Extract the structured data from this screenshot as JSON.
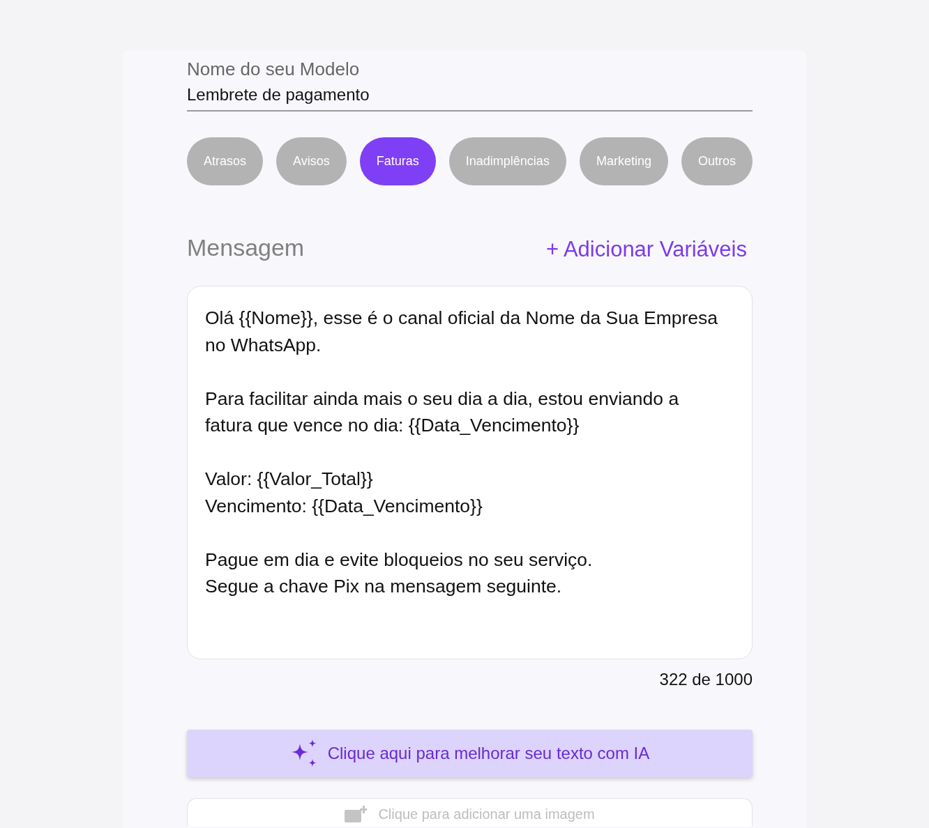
{
  "template_name": {
    "label": "Nome do seu Modelo",
    "value": "Lembrete de pagamento"
  },
  "categories": [
    {
      "label": "Atrasos",
      "selected": false
    },
    {
      "label": "Avisos",
      "selected": false
    },
    {
      "label": "Faturas",
      "selected": true
    },
    {
      "label": "Inadimplências",
      "selected": false
    },
    {
      "label": "Marketing",
      "selected": false
    },
    {
      "label": "Outros",
      "selected": false
    }
  ],
  "message": {
    "title": "Mensagem",
    "add_variables": "+ Adicionar Variáveis",
    "value": "Olá {{Nome}}, esse é o canal oficial da Nome da Sua Empresa no WhatsApp.\n\nPara facilitar ainda mais o seu dia a dia, estou enviando a fatura que vence no dia: {{Data_Vencimento}}\n\nValor: {{Valor_Total}}\nVencimento: {{Data_Vencimento}}\n\nPague em dia e evite bloqueios no seu serviço.\nSegue a chave Pix na mensagem seguinte.",
    "counter": "322 de 1000"
  },
  "ai_button": {
    "label": "Clique aqui para melhorar seu texto com IA"
  },
  "image_upload": {
    "label": "Clique para adicionar uma imagem"
  }
}
